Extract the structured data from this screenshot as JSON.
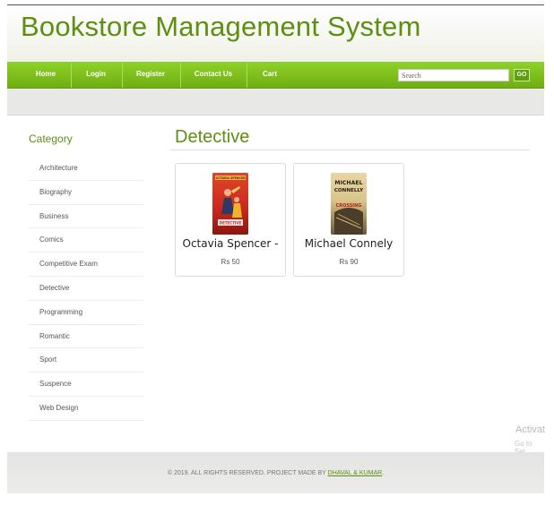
{
  "header": {
    "title": "Bookstore Management System"
  },
  "nav": {
    "items": [
      "Home",
      "Login",
      "Register",
      "Contact Us",
      "Cart"
    ],
    "search_placeholder": "Search",
    "go_label": "GO"
  },
  "sidebar": {
    "heading": "Category",
    "items": [
      "Architecture",
      "Biography",
      "Business",
      "Comics",
      "Competitive Exam",
      "Detective",
      "Programming",
      "Romantic",
      "Sport",
      "Suspence",
      "Web Design"
    ]
  },
  "main": {
    "title": "Detective",
    "products": [
      {
        "title": "Octavia Spencer -",
        "price": "Rs 50",
        "cover_author": "OCTAVIA SPENCER",
        "cover_title": "DETECTIVE"
      },
      {
        "title": "Michael Connely",
        "price": "Rs 90",
        "cover_author": "MICHAEL CONNELLY",
        "cover_title": "CROSSING"
      }
    ]
  },
  "watermark": {
    "line1": "Activat",
    "line2": "Go to Set"
  },
  "footer": {
    "text": "© 2019. ALL RIGHTS RESERVED. PROJECT MADE BY ",
    "link": "DHAVAL & KUMAR",
    "suffix": "."
  }
}
